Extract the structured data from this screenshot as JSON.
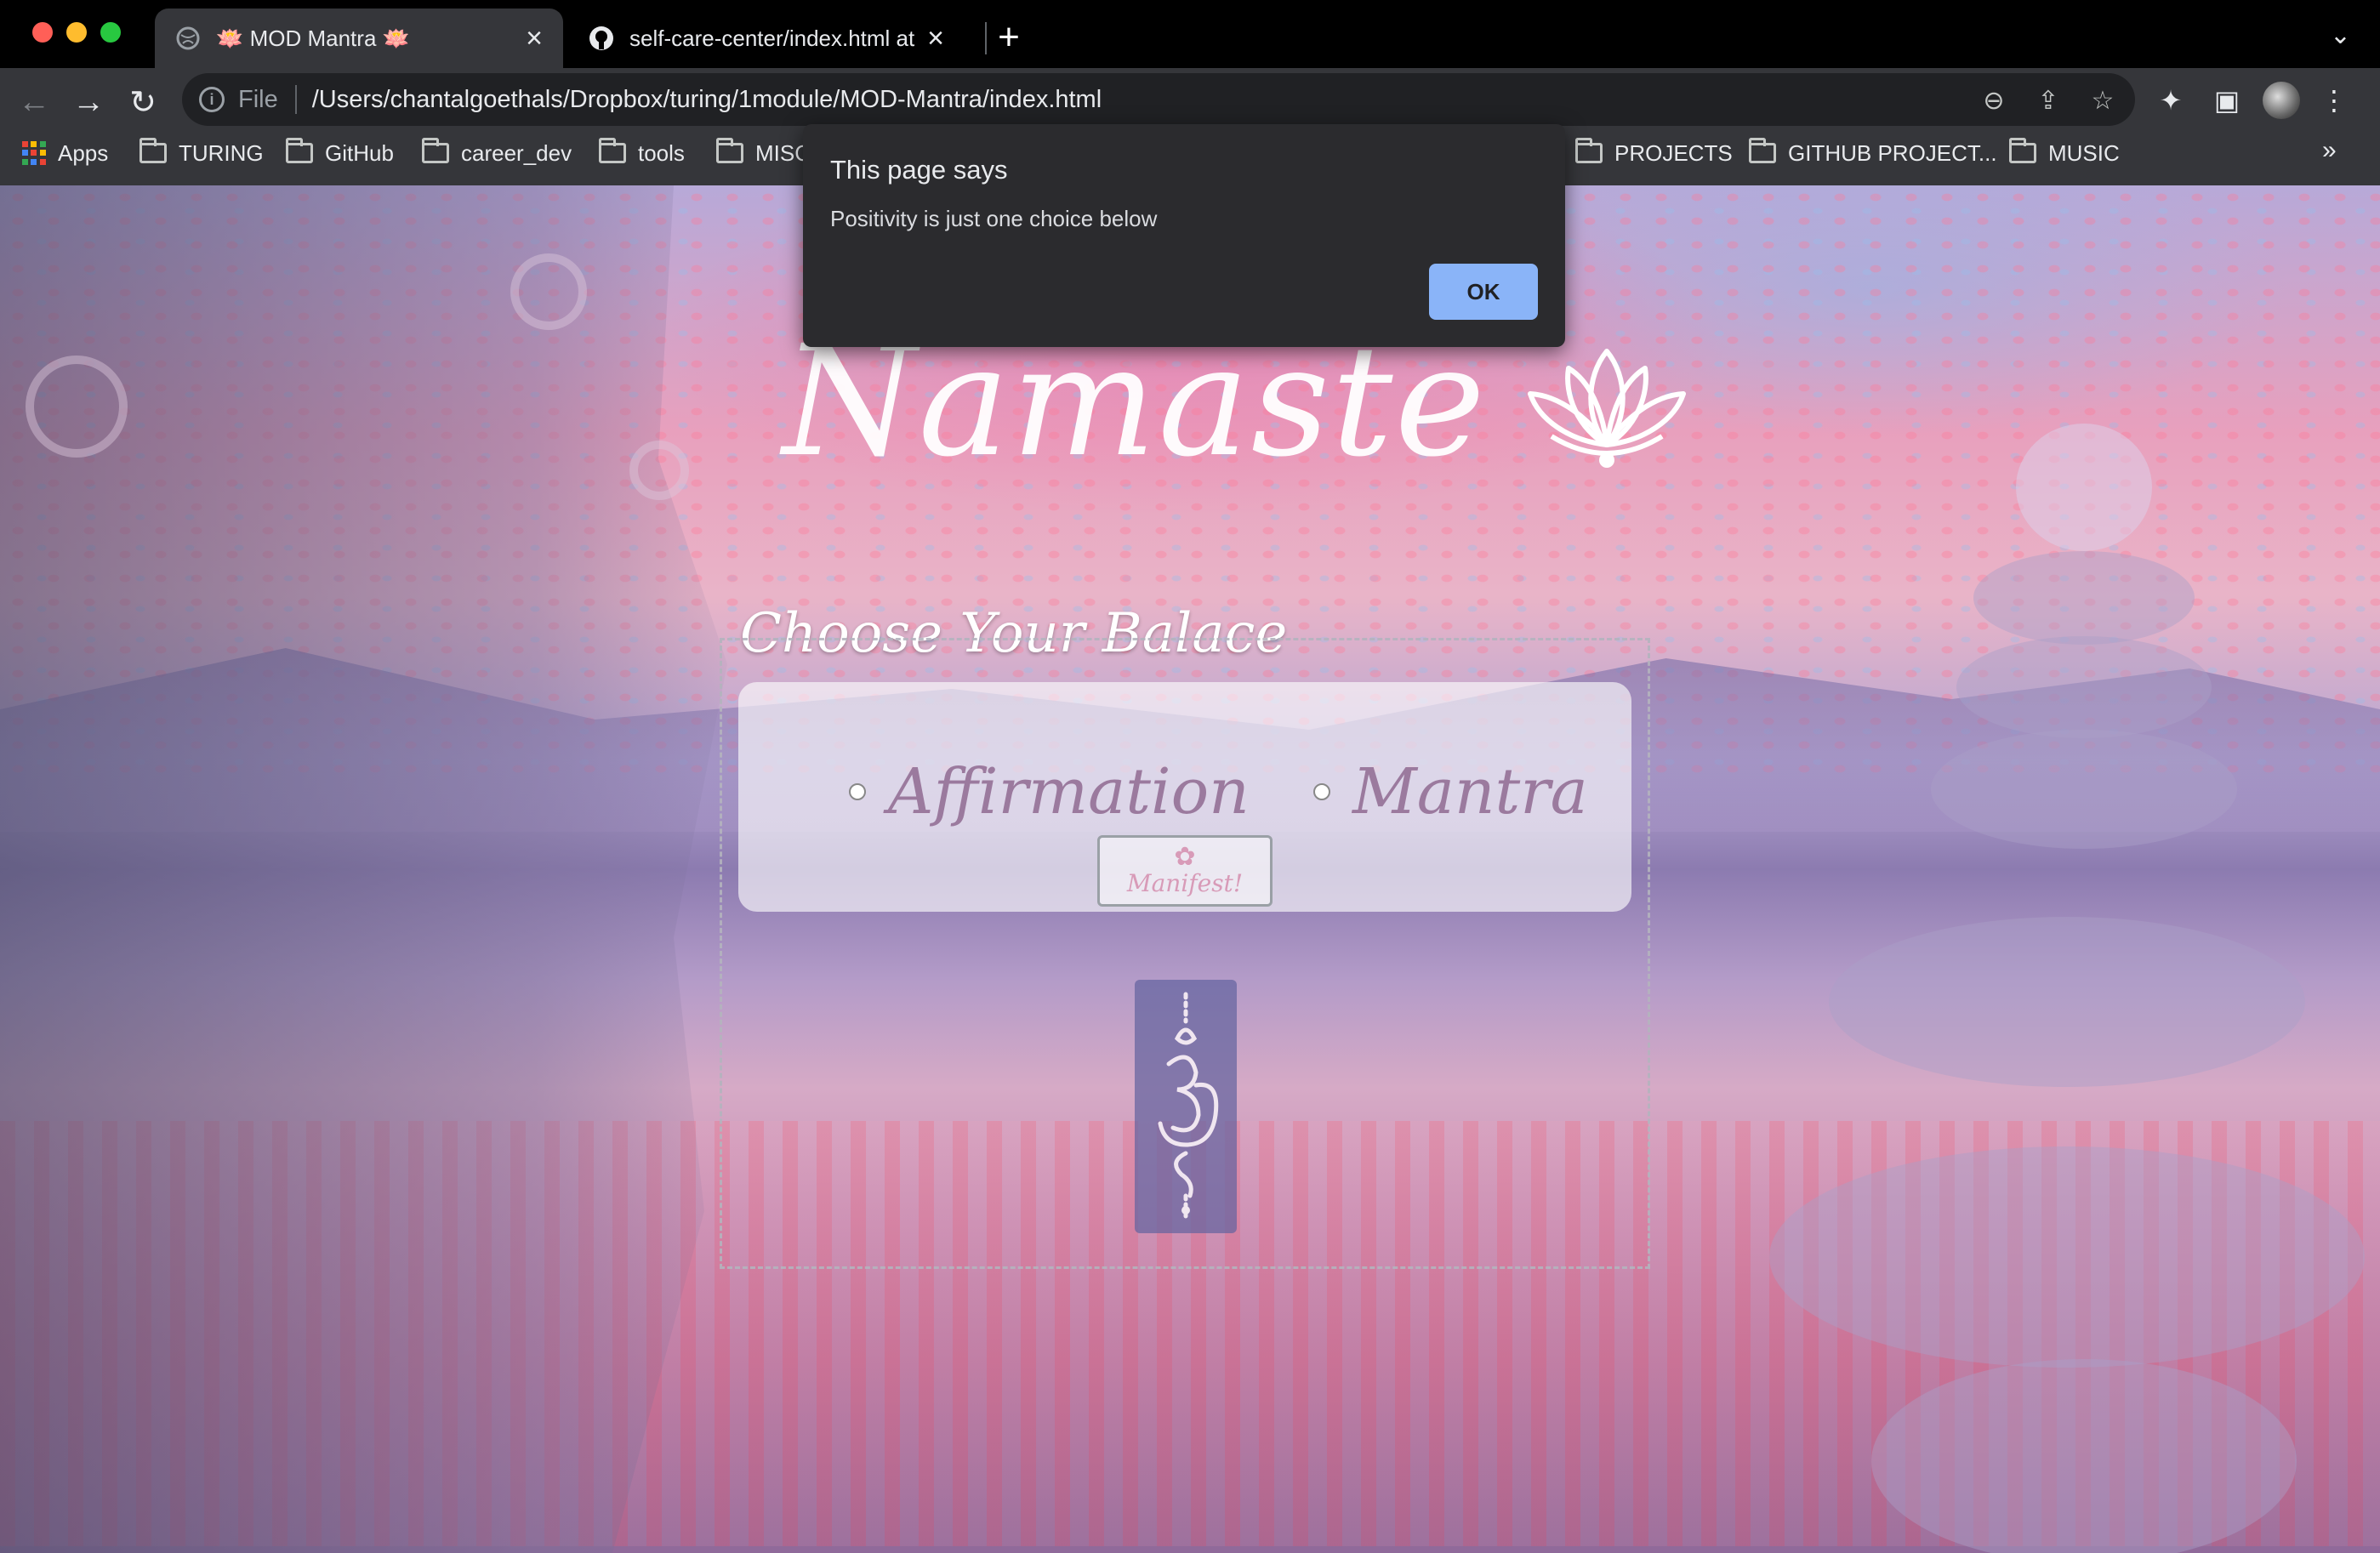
{
  "browser": {
    "tabs": [
      {
        "title": "🪷 MOD Mantra 🪷",
        "active": true,
        "favicon": "globe-icon"
      },
      {
        "title": "self-care-center/index.html at",
        "active": false,
        "favicon": "github-icon"
      }
    ],
    "address_bar": {
      "scheme_label": "File",
      "url": "/Users/chantalgoethals/Dropbox/turing/1module/MOD-Mantra/index.html"
    },
    "bookmarks": [
      "Apps",
      "TURING",
      "GitHub",
      "career_dev",
      "tools",
      "MISC",
      "PROJECTS",
      "GITHUB PROJECT...",
      "MUSIC"
    ]
  },
  "dialog": {
    "title": "This page says",
    "message": "Positivity is just one choice below",
    "ok_label": "OK"
  },
  "page": {
    "title": "Namaste",
    "choose_label": "Choose Your Balace",
    "options": [
      "Affirmation",
      "Mantra"
    ],
    "manifest_label": "Manifest!"
  },
  "colors": {
    "chrome_bg": "#35363a",
    "tabstrip_bg": "#000000",
    "dialog_bg": "#2b2b2e",
    "ok_button": "#8ab4f8",
    "option_text": "#9b7a9e"
  }
}
